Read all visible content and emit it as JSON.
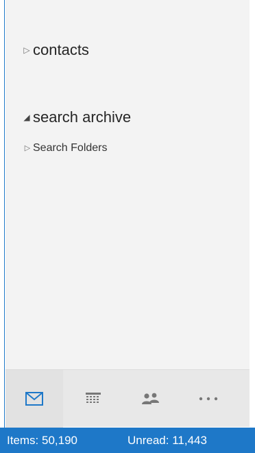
{
  "folders": [
    {
      "label": "contacts",
      "expanded": false,
      "arrow_icon": "collapsed-triangle-icon"
    },
    {
      "label": "search archive",
      "expanded": true,
      "arrow_icon": "expanded-triangle-icon"
    },
    {
      "label": "Search Folders",
      "expanded": false,
      "arrow_icon": "collapsed-triangle-icon"
    }
  ],
  "nav": {
    "items": [
      {
        "name": "mail",
        "icon": "mail-icon",
        "active": true
      },
      {
        "name": "calendar",
        "icon": "calendar-icon",
        "active": false
      },
      {
        "name": "people",
        "icon": "people-icon",
        "active": false
      },
      {
        "name": "more",
        "icon": "more-icon",
        "active": false
      }
    ]
  },
  "status": {
    "items_text": "Items: 50,190",
    "unread_text": "Unread: 11,443"
  },
  "colors": {
    "accent": "#1e78c8",
    "pane_background": "#f3f3f3",
    "nav_background": "#e8e8e8",
    "icon_gray": "#777777"
  }
}
